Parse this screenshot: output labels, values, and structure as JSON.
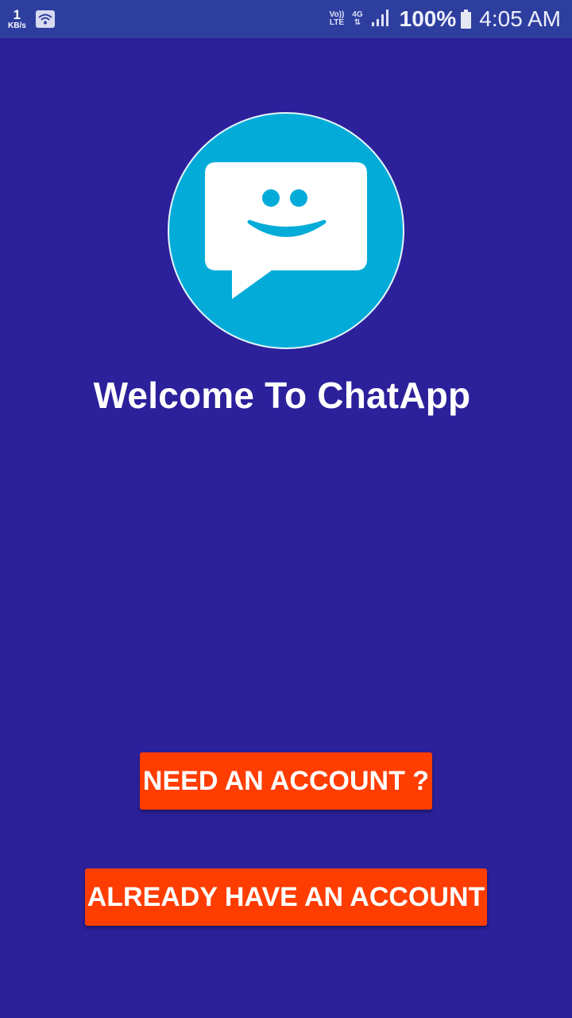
{
  "status_bar": {
    "net_speed_value": "1",
    "net_speed_unit": "KB/s",
    "volte_top": "Vo))",
    "volte_bottom": "LTE",
    "network_type": "4G",
    "network_arrows": "⇅",
    "battery_percent": "100%",
    "time": "4:05 AM",
    "icons": [
      "wifi-icon",
      "signal-icon",
      "battery-icon"
    ]
  },
  "welcome": {
    "logo_icon": "chat-smiley-icon",
    "title": "Welcome To ChatApp"
  },
  "actions": {
    "need_account_label": "NEED AN ACCOUNT ?",
    "already_account_label": "ALREADY HAVE AN ACCOUNT"
  },
  "colors": {
    "background": "#2c209b",
    "status_bar": "#2e3e9f",
    "logo_circle": "#03acd8",
    "button": "#ff3d00",
    "text": "#ffffff"
  }
}
